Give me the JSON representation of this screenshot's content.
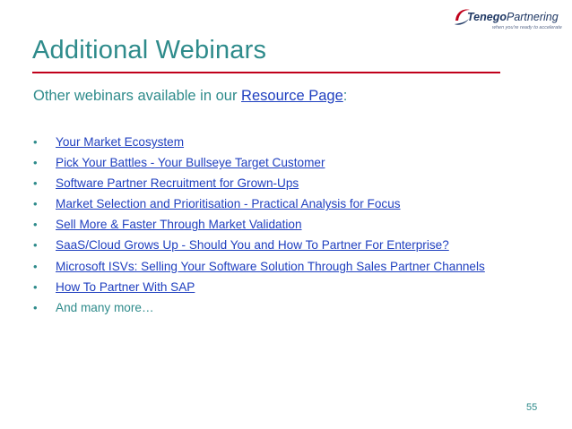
{
  "logo": {
    "brand_part1": "Tenego",
    "brand_part2": "Partnering",
    "tagline": "when you're ready to accelerate"
  },
  "title": "Additional Webinars",
  "subtitle": {
    "prefix": "Other webinars available in our ",
    "link": "Resource Page",
    "suffix": ":"
  },
  "webinars": [
    "Your Market Ecosystem",
    "Pick Your Battles - Your Bullseye Target Customer",
    "Software Partner Recruitment for Grown-Ups",
    "Market Selection and Prioritisation - Practical Analysis for Focus",
    "Sell More & Faster Through Market Validation",
    "SaaS/Cloud Grows Up - Should You and How To Partner For Enterprise?",
    "Microsoft ISVs: Selling Your Software Solution Through Sales Partner Channels",
    "How To Partner With SAP"
  ],
  "more_text": "And many more…",
  "bullet_char": "•",
  "page_number": "55",
  "colors": {
    "accent_teal": "#2e8b8b",
    "link_blue": "#1f3fbf",
    "rule_red": "#c0001a",
    "logo_navy": "#1f3864"
  }
}
